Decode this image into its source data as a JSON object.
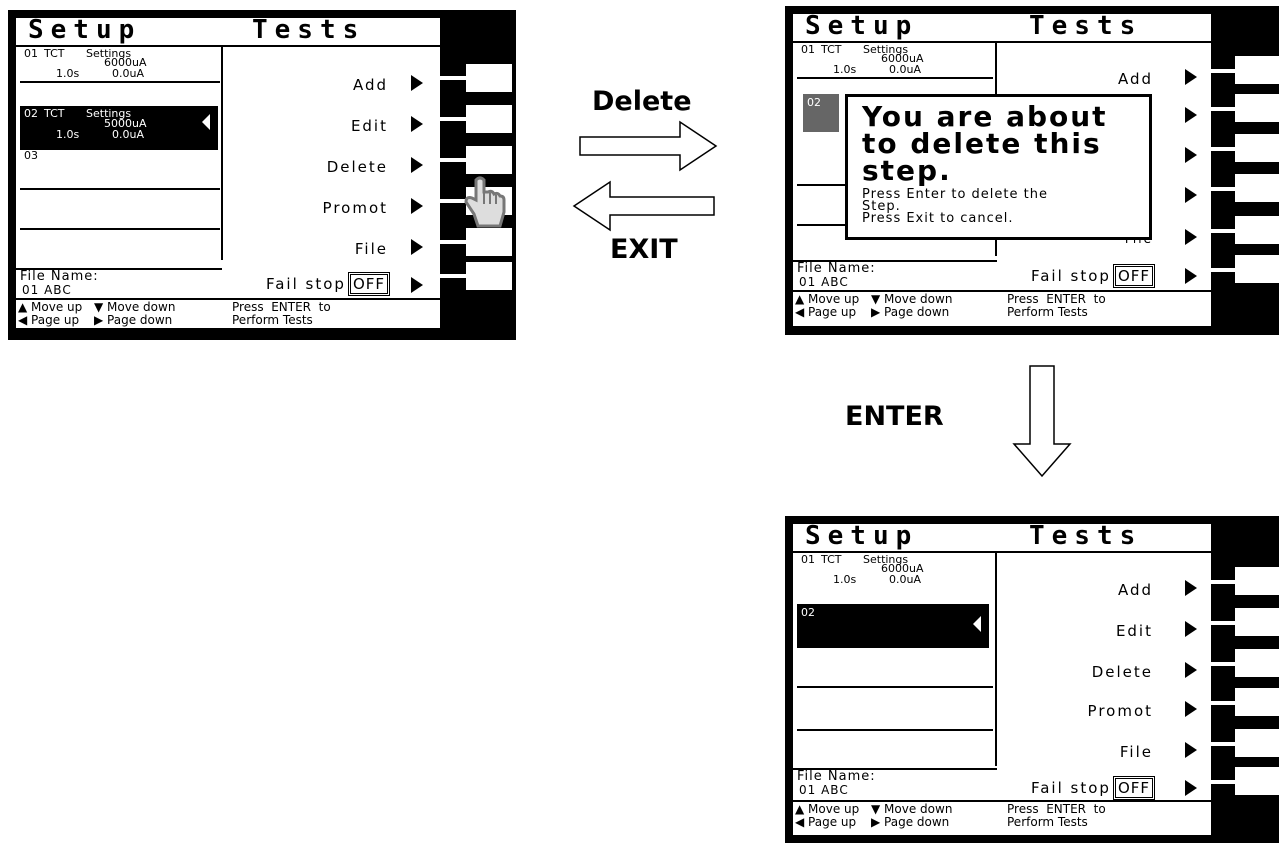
{
  "screen": {
    "title_left": "Setup",
    "title_right": "Tests",
    "steps": {
      "s1": {
        "num": "01",
        "mode": "TCT",
        "settings": "Settings",
        "current": "6000uA",
        "time": "1.0s",
        "low": "0.0uA"
      },
      "s2": {
        "num": "02",
        "mode": "TCT",
        "settings": "Settings",
        "current": "5000uA",
        "time": "1.0s",
        "low": "0.0uA"
      },
      "s3": {
        "num": "03"
      },
      "s2_new": {
        "num": "02"
      }
    },
    "menu": {
      "add": "Add",
      "edit": "Edit",
      "delete": "Delete",
      "promot": "Promot",
      "file": "File",
      "fail_stop": "Fail stop",
      "fail_stop_value": "OFF",
      "file_partial": "File"
    },
    "file_name_label": "File Name:",
    "file_name_value": "01  ABC",
    "footer": {
      "move_up": "Move up",
      "move_down": "Move down",
      "page_up": "Page up",
      "page_down": "Page down",
      "press_enter": "Press  ENTER  to",
      "perform": "Perform Tests"
    },
    "popup": {
      "line1": "You are about",
      "line2": "to delete this",
      "line3": "step.",
      "msg1": "Press Enter to delete the",
      "msg2": "Step.",
      "msg3": "Press Exit to cancel."
    }
  },
  "labels": {
    "delete": "Delete",
    "exit": "EXIT",
    "enter": "ENTER"
  },
  "icons": {
    "pointer": "hand-pointer-icon",
    "up": "triangle-up-icon",
    "down": "triangle-down-icon",
    "left": "triangle-left-icon",
    "right": "triangle-right-icon"
  }
}
